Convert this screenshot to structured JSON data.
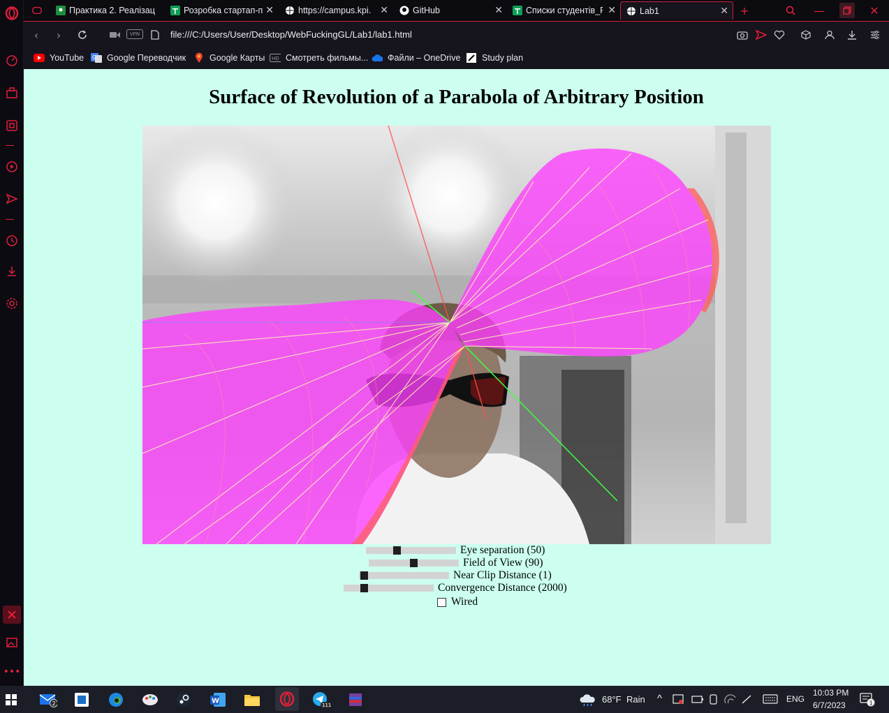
{
  "browser": {
    "tabs": [
      {
        "title": "Практика 2. Реалізац",
        "favicon": "classroom-icon",
        "color": "#1e8e3e"
      },
      {
        "title": "Розробка стартап-п",
        "favicon": "sheets-icon",
        "color": "#0f9d58"
      },
      {
        "title": "https://campus.kpi.ua",
        "favicon": "globe-icon",
        "color": "#ffffff"
      },
      {
        "title": "GitHub",
        "favicon": "github-icon",
        "color": "#ffffff"
      },
      {
        "title": "Списки студентів_Р",
        "favicon": "sheets-icon",
        "color": "#0f9d58"
      },
      {
        "title": "Lab1",
        "favicon": "globe-icon",
        "color": "#ffffff",
        "active": true
      }
    ],
    "url": "file:///C:/Users/User/Desktop/WebFuckingGL/Lab1/lab1.html",
    "vpn_label": "VPN",
    "bookmarks": [
      {
        "label": "YouTube",
        "icon": "youtube-icon"
      },
      {
        "label": "Google Переводчик",
        "icon": "google-translate-icon"
      },
      {
        "label": "Google Карты",
        "icon": "google-maps-icon"
      },
      {
        "label": "Смотреть фильмы...",
        "icon": "hd-icon"
      },
      {
        "label": "Файли – OneDrive",
        "icon": "onedrive-icon"
      },
      {
        "label": "Study plan",
        "icon": "notion-icon"
      }
    ],
    "accent": "#e0203a"
  },
  "page": {
    "title": "Surface of Revolution of a Parabola of Arbitrary Position",
    "background": "#ccfff0",
    "controls": {
      "eye_separation": {
        "label": "Eye separation (50)",
        "value": 50,
        "min": 0,
        "max": 150
      },
      "field_of_view": {
        "label": "Field of View (90)",
        "value": 90,
        "min": 0,
        "max": 180
      },
      "near_clip": {
        "label": "Near Clip Distance (1)",
        "value": 1,
        "min": 0,
        "max": 50
      },
      "convergence": {
        "label": "Convergence Distance (2000)",
        "value": 2000,
        "min": 0,
        "max": 10000
      },
      "wired_label": "Wired"
    }
  },
  "taskbar": {
    "mail_badge": "2",
    "telegram_badge": "111",
    "weather_temp": "68°F",
    "weather_text": "Rain",
    "language": "ENG",
    "time": "10:03 PM",
    "date": "6/7/2023",
    "notification_count": "1"
  }
}
